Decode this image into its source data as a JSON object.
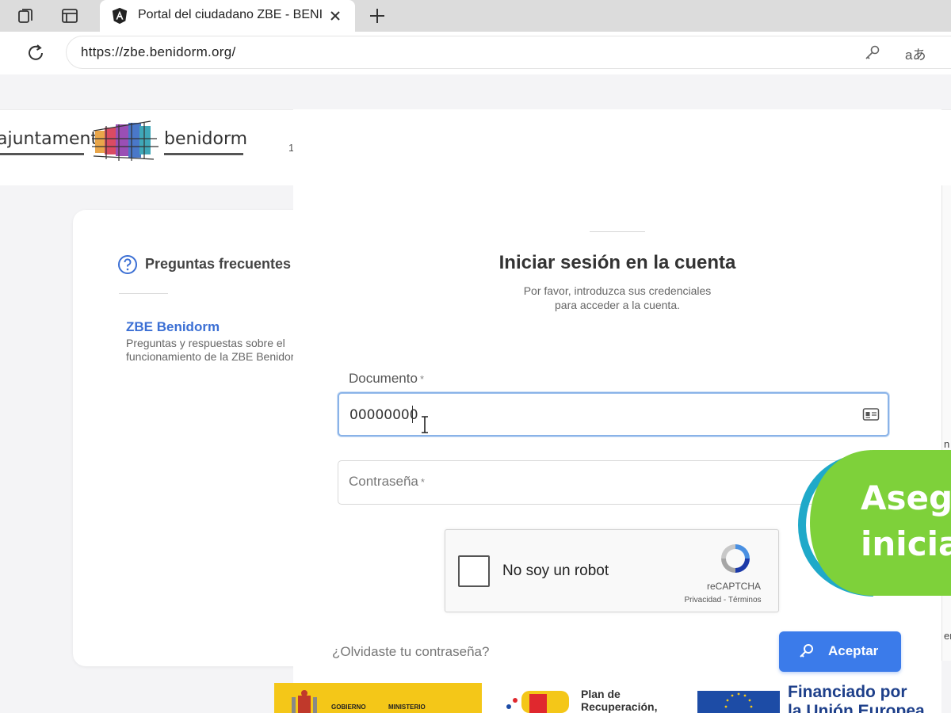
{
  "browser": {
    "tab_title": "Portal del ciudadano ZBE - BENIDORM",
    "url": "https://zbe.benidorm.org/",
    "read_aloud_label": "aあ"
  },
  "header": {
    "logo_left": "ajuntament",
    "logo_right": "benidorm",
    "extra": "1"
  },
  "faq": {
    "title": "Preguntas frecuentes",
    "link_title": "ZBE Benidorm",
    "link_desc": "Preguntas y respuestas sobre el funcionamiento de la ZBE Benidorm"
  },
  "login": {
    "title": "Iniciar sesión en la cuenta",
    "subtitle_line1": "Por favor, introduzca sus credenciales",
    "subtitle_line2": "para acceder a la cuenta.",
    "document_label": "Documento",
    "document_value": "00000000",
    "password_placeholder": "Contraseña",
    "required_mark": "*",
    "captcha_label": "No soy un robot",
    "captcha_brand": "reCAPTCHA",
    "captcha_links": "Privacidad - Términos",
    "forgot_password": "¿Olvidaste tu contraseña?",
    "accept_button": "Aceptar"
  },
  "overlay": {
    "line1": "Asegú",
    "line2": "iniciad",
    "color": "#7ed13a",
    "ring_color": "#1fa9c9"
  },
  "footer": {
    "gov_text1": "GOBIERNO",
    "gov_text2": "MINISTERIO",
    "prtr_line1": "Plan de",
    "prtr_line2": "Recuperación,",
    "eu_line1": "Financiado por",
    "eu_line2": "la Unión Europea"
  },
  "right_strip": [
    "n",
    "er"
  ]
}
